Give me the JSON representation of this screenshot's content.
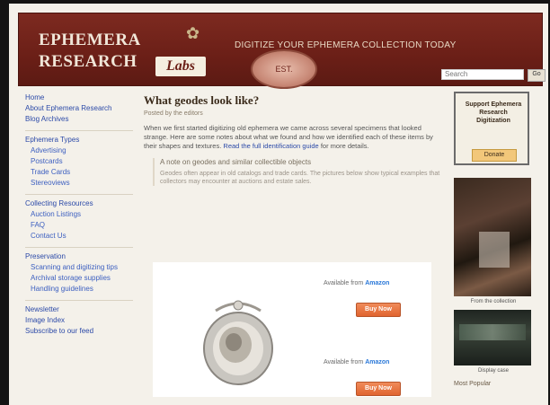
{
  "header": {
    "logo_line1": "EPHEMERA",
    "logo_line2": "RESEARCH",
    "logo_badge": "Labs",
    "tagline": "DIGITIZE YOUR EPHEMERA COLLECTION TODAY",
    "seal_text": "EST.",
    "search_placeholder": "Search",
    "search_button": "Go"
  },
  "sidebar": {
    "groups": [
      [
        "Home",
        "About Ephemera Research",
        "Blog Archives"
      ],
      [
        "Ephemera Types",
        "Advertising",
        "Postcards",
        "Trade Cards",
        "Stereoviews"
      ],
      [
        "Collecting Resources",
        "Auction Listings",
        "FAQ",
        "Contact Us"
      ],
      [
        "Preservation",
        "Scanning and digitizing tips",
        "Archival storage supplies",
        "Handling guidelines"
      ],
      [
        "Newsletter",
        "Image Index",
        "Subscribe to our feed"
      ]
    ]
  },
  "main": {
    "title": "What geodes look like?",
    "meta": "Posted by the editors",
    "paragraph": "When we first started digitizing old ephemera we came across several specimens that looked strange. Here are some notes about what we found and how we identified each of these items by their shapes and textures.",
    "link_text": "Read the full identification guide",
    "paragraph_tail": "for more details.",
    "quote_head": "A note on geodes and similar collectible objects",
    "quote_body": "Geodes often appear in old catalogs and trade cards. The pictures below show typical examples that collectors may encounter at auctions and estate sales.",
    "product": {
      "row1_label": "Available from",
      "row1_store": "Amazon",
      "row1_button": "Buy Now",
      "row2_label": "Available from",
      "row2_store": "Amazon",
      "row2_button": "Buy Now"
    }
  },
  "right": {
    "ad_text": "Support Ephemera Research Digitization",
    "ad_button": "Donate",
    "photo1_caption": "From the collection",
    "photo2_caption": "Display case",
    "section_head": "Most Popular"
  },
  "colors": {
    "header_bg": "#6b1f17",
    "link": "#2c4aa8",
    "buy_button": "#e0642f"
  }
}
